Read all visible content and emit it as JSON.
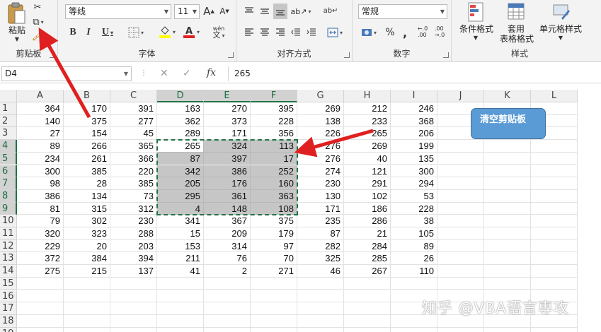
{
  "ribbon": {
    "clipboard": {
      "paste_label": "粘贴",
      "group_label": "剪贴板"
    },
    "font": {
      "font_name": "等线",
      "font_size": "11",
      "group_label": "字体",
      "bold": "B",
      "italic": "I",
      "underline": "U",
      "grow": "A",
      "shrink": "A",
      "wen": "wén"
    },
    "alignment": {
      "group_label": "对齐方式"
    },
    "number": {
      "format": "常规",
      "group_label": "数字",
      "percent": "%",
      "comma": ","
    },
    "styles": {
      "cond_format": "条件格式",
      "table_format_1": "套用",
      "table_format_2": "表格格式",
      "cell_styles": "单元格样式",
      "group_label": "样式"
    }
  },
  "formula_bar": {
    "name_box": "D4",
    "formula": "265",
    "fx": "fx"
  },
  "columns": [
    "A",
    "B",
    "C",
    "D",
    "E",
    "F",
    "G",
    "H",
    "I",
    "J",
    "K",
    "L"
  ],
  "rows": [
    "1",
    "2",
    "3",
    "4",
    "5",
    "6",
    "7",
    "8",
    "9",
    "10",
    "11",
    "12",
    "13",
    "14",
    "15",
    "16",
    "17",
    "18",
    "19"
  ],
  "cells": [
    [
      364,
      170,
      391,
      163,
      270,
      395,
      269,
      212,
      246
    ],
    [
      140,
      375,
      277,
      362,
      373,
      228,
      138,
      233,
      368
    ],
    [
      27,
      154,
      45,
      289,
      171,
      356,
      226,
      265,
      206
    ],
    [
      89,
      266,
      365,
      265,
      324,
      113,
      276,
      269,
      199
    ],
    [
      234,
      261,
      366,
      87,
      397,
      17,
      276,
      40,
      135
    ],
    [
      300,
      385,
      220,
      342,
      386,
      252,
      274,
      121,
      300
    ],
    [
      98,
      28,
      385,
      205,
      176,
      160,
      230,
      291,
      294
    ],
    [
      386,
      134,
      73,
      295,
      361,
      363,
      130,
      102,
      53
    ],
    [
      81,
      315,
      312,
      4,
      148,
      108,
      171,
      186,
      228
    ],
    [
      79,
      302,
      230,
      341,
      367,
      375,
      235,
      286,
      38
    ],
    [
      320,
      323,
      288,
      15,
      209,
      179,
      87,
      21,
      105
    ],
    [
      229,
      20,
      203,
      153,
      314,
      97,
      282,
      284,
      89
    ],
    [
      372,
      384,
      394,
      211,
      76,
      70,
      325,
      285,
      26
    ],
    [
      275,
      215,
      137,
      41,
      2,
      271,
      46,
      267,
      110
    ]
  ],
  "shape": {
    "label": "清空剪贴板"
  },
  "watermark": "知乎 @VBA语言専攻",
  "colors": {
    "accent": "#217346",
    "arrow": "#e02020",
    "shape_fill": "#5b9bd5"
  }
}
